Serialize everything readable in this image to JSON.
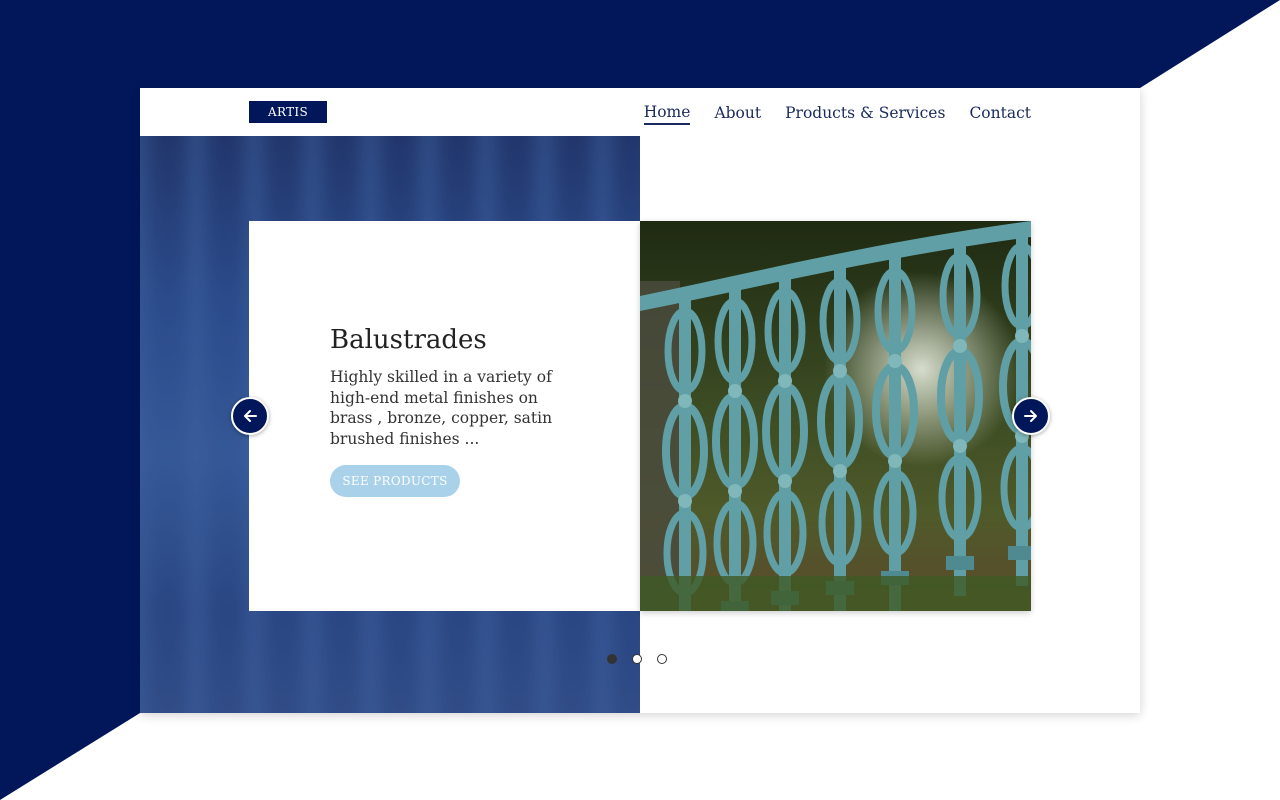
{
  "colors": {
    "brand_navy": "#02175a",
    "nav_text": "#1a2a5e",
    "button_bg": "#a9d1ea",
    "railing_teal": "#5f9fa5"
  },
  "header": {
    "logo": "ARTIS",
    "nav": [
      {
        "label": "Home",
        "active": true
      },
      {
        "label": "About",
        "active": false
      },
      {
        "label": "Products & Services",
        "active": false
      },
      {
        "label": "Contact",
        "active": false
      }
    ]
  },
  "slider": {
    "slide": {
      "title": "Balustrades",
      "description": "Highly skilled in a variety of high-end metal finishes on brass , bronze, copper, satin brushed finishes ...",
      "button_label": "SEE PRODUCTS",
      "image_subject": "teal ornate cast-iron balustrade railing"
    },
    "prev_icon": "arrow-left-icon",
    "next_icon": "arrow-right-icon",
    "dots": [
      {
        "active": true
      },
      {
        "active": false
      },
      {
        "active": false
      }
    ]
  }
}
